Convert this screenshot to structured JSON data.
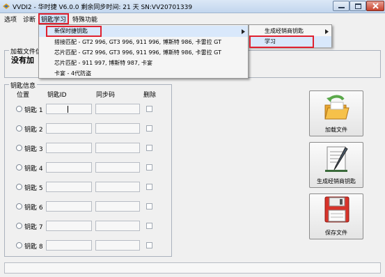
{
  "window": {
    "title": "VVDI2 - 华时捷 V6.0.0    剩余同步时间: 21 天    SN:VV20701339"
  },
  "menubar": {
    "items": [
      "选项",
      "诊断",
      "钥匙学习",
      "特殊功能"
    ]
  },
  "load_file_group": {
    "label": "加载文件信",
    "status_text": "没有加"
  },
  "key_info": {
    "label": "钥匙信息",
    "columns": [
      "位置",
      "钥匙ID",
      "同步码",
      "删除"
    ],
    "rows": [
      {
        "label": "钥匙 1"
      },
      {
        "label": "钥匙 2"
      },
      {
        "label": "钥匙 3"
      },
      {
        "label": "钥匙 4"
      },
      {
        "label": "钥匙 5"
      },
      {
        "label": "钥匙 6"
      },
      {
        "label": "钥匙 7"
      },
      {
        "label": "钥匙 8"
      }
    ]
  },
  "dropdown_main": {
    "items": [
      {
        "label": "新保时捷钥匙",
        "has_submenu": true
      },
      {
        "label": "搭接匹配 - GT2 996, GT3 996, 911 996, 博斯特 986, 卡雷拉 GT",
        "has_submenu": false
      },
      {
        "label": "芯片匹配 - GT2 996, GT3 996, 911 996, 博斯特 986, 卡雷拉 GT",
        "has_submenu": false
      },
      {
        "label": "芯片匹配 - 911 997, 博斯特 987, 卡宴",
        "has_submenu": false
      },
      {
        "label": "卡宴 - 4代防盗",
        "has_submenu": false
      }
    ]
  },
  "dropdown_sub": {
    "items": [
      {
        "label": "生成经销商钥匙",
        "has_submenu": true
      },
      {
        "label": "学习",
        "has_submenu": false
      }
    ]
  },
  "buttons": {
    "load_file": "加载文件",
    "generate_dealer_key": "生成经销商钥匙",
    "save_file": "保存文件"
  },
  "icons": {
    "folder": "folder-open-icon",
    "document_pen": "document-pen-icon",
    "floppy": "floppy-disk-icon"
  }
}
